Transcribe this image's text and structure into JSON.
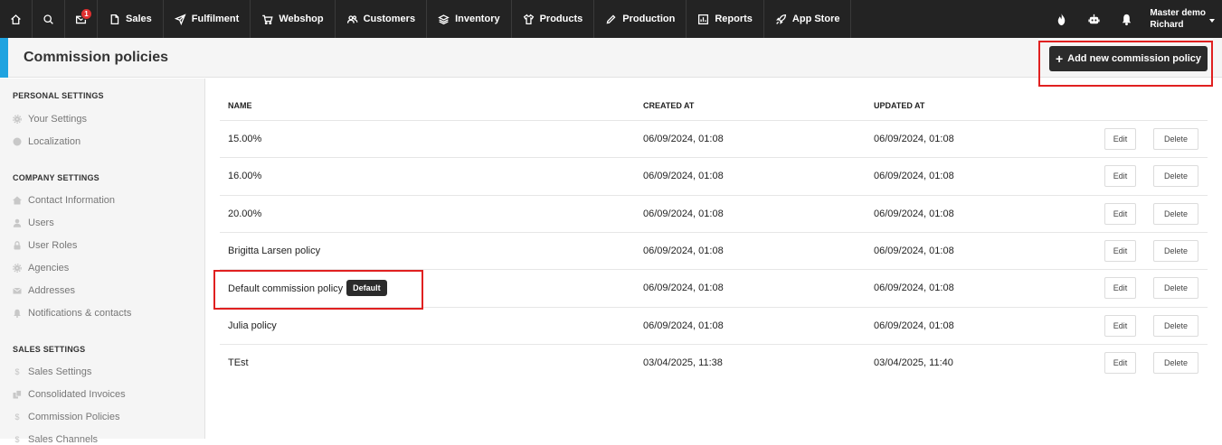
{
  "nav": {
    "mail_badge": "1",
    "items": [
      {
        "label": "Sales",
        "icon": "file-icon"
      },
      {
        "label": "Fulfilment",
        "icon": "send-icon"
      },
      {
        "label": "Webshop",
        "icon": "cart-icon"
      },
      {
        "label": "Customers",
        "icon": "users-icon"
      },
      {
        "label": "Inventory",
        "icon": "layers-icon"
      },
      {
        "label": "Products",
        "icon": "shirt-icon"
      },
      {
        "label": "Production",
        "icon": "pencil-icon"
      },
      {
        "label": "Reports",
        "icon": "chart-icon"
      },
      {
        "label": "App Store",
        "icon": "rocket-icon"
      }
    ],
    "user_line1": "Master demo",
    "user_line2": "Richard"
  },
  "header": {
    "title": "Commission policies",
    "add_button": "Add new commission policy",
    "accent_color": "#1fa3e0"
  },
  "sidebar": {
    "sections": [
      {
        "heading": "PERSONAL SETTINGS",
        "items": [
          {
            "label": "Your Settings",
            "icon": "gear-icon"
          },
          {
            "label": "Localization",
            "icon": "globe-icon"
          }
        ]
      },
      {
        "heading": "COMPANY SETTINGS",
        "items": [
          {
            "label": "Contact Information",
            "icon": "home-icon"
          },
          {
            "label": "Users",
            "icon": "user-icon"
          },
          {
            "label": "User Roles",
            "icon": "lock-icon"
          },
          {
            "label": "Agencies",
            "icon": "gear-icon"
          },
          {
            "label": "Addresses",
            "icon": "envelope-icon"
          },
          {
            "label": "Notifications & contacts",
            "icon": "bell-icon"
          }
        ]
      },
      {
        "heading": "SALES SETTINGS",
        "items": [
          {
            "label": "Sales Settings",
            "icon": "dollar-icon"
          },
          {
            "label": "Consolidated Invoices",
            "icon": "invoices-icon"
          },
          {
            "label": "Commission Policies",
            "icon": "dollar-icon"
          },
          {
            "label": "Sales Channels",
            "icon": "dollar-icon"
          }
        ]
      }
    ]
  },
  "table": {
    "headers": {
      "name": "NAME",
      "created": "CREATED AT",
      "updated": "UPDATED AT"
    },
    "edit_label": "Edit",
    "delete_label": "Delete",
    "default_badge": "Default",
    "rows": [
      {
        "name": "15.00%",
        "created": "06/09/2024, 01:08",
        "updated": "06/09/2024, 01:08",
        "is_default": false
      },
      {
        "name": "16.00%",
        "created": "06/09/2024, 01:08",
        "updated": "06/09/2024, 01:08",
        "is_default": false
      },
      {
        "name": "20.00%",
        "created": "06/09/2024, 01:08",
        "updated": "06/09/2024, 01:08",
        "is_default": false
      },
      {
        "name": "Brigitta Larsen policy",
        "created": "06/09/2024, 01:08",
        "updated": "06/09/2024, 01:08",
        "is_default": false
      },
      {
        "name": "Default commission policy",
        "created": "06/09/2024, 01:08",
        "updated": "06/09/2024, 01:08",
        "is_default": true
      },
      {
        "name": "Julia policy",
        "created": "06/09/2024, 01:08",
        "updated": "06/09/2024, 01:08",
        "is_default": false
      },
      {
        "name": "TEst",
        "created": "03/04/2025, 11:38",
        "updated": "03/04/2025, 11:40",
        "is_default": false
      }
    ]
  }
}
